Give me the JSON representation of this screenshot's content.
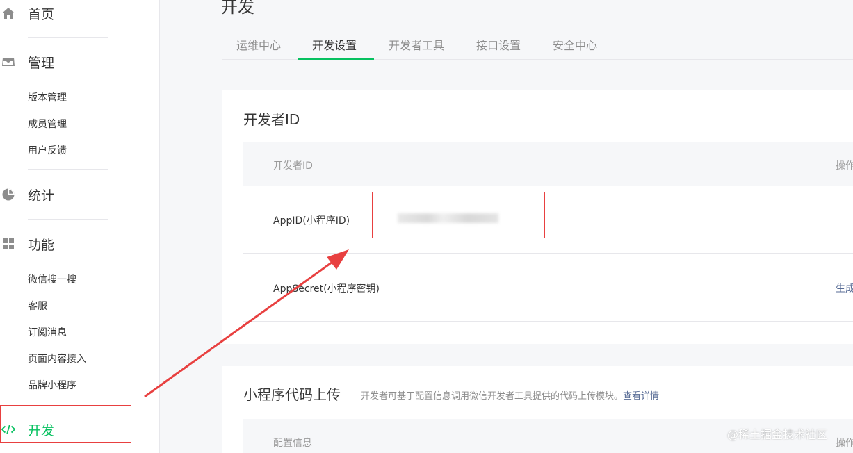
{
  "sidebar": {
    "home_label": "首页",
    "manage_label": "管理",
    "manage_items": [
      "版本管理",
      "成员管理",
      "用户反馈"
    ],
    "stats_label": "统计",
    "features_label": "功能",
    "feature_items": [
      "微信搜一搜",
      "客服",
      "订阅消息",
      "页面内容接入",
      "品牌小程序"
    ],
    "dev_label": "开发",
    "icons": {
      "home": "home-icon",
      "manage": "inbox-icon",
      "stats": "pie-chart-icon",
      "features": "grid-icon",
      "dev": "code-icon"
    }
  },
  "page": {
    "title": "开发",
    "tabs": [
      "运维中心",
      "开发设置",
      "开发者工具",
      "接口设置",
      "安全中心"
    ],
    "active_tab": "开发设置"
  },
  "developer_id": {
    "title": "开发者ID",
    "col_id": "开发者ID",
    "col_action": "操作",
    "appid_label": "AppID(小程序ID)",
    "appsecret_label": "AppSecret(小程序密钥)",
    "appsecret_action": "生成"
  },
  "code_upload": {
    "title": "小程序代码上传",
    "description": "开发者可基于配置信息调用微信开发者工具提供的代码上传模块。",
    "details_link": "查看详情",
    "col_config": "配置信息",
    "col_action": "操作"
  },
  "watermark": "@稀土掘金技术社区",
  "colors": {
    "accent": "#07c160",
    "link": "#576b95",
    "annotation": "#e84040"
  }
}
